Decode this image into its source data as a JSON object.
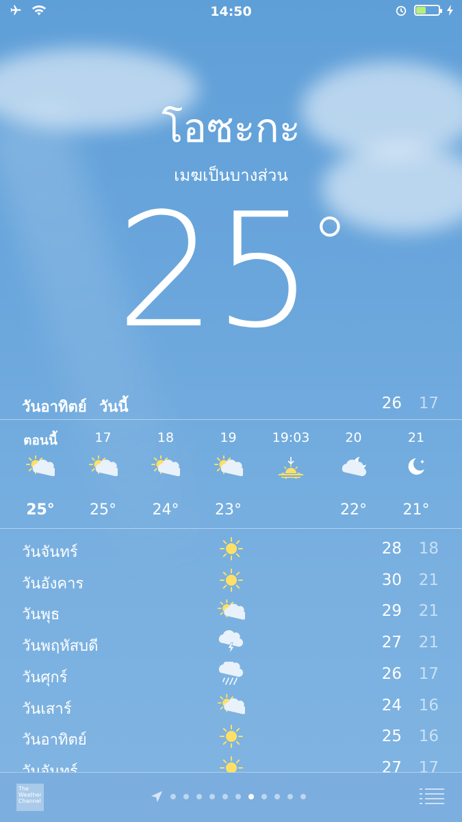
{
  "status_bar": {
    "time": "14:50"
  },
  "header": {
    "city": "โอซะกะ",
    "condition": "เมฆเป็นบางส่วน",
    "temperature": "25",
    "degree_symbol": "°"
  },
  "today": {
    "day": "วันอาทิตย์",
    "label": "วันนี้",
    "high": "26",
    "low": "17"
  },
  "hourly": [
    {
      "hour": "ตอนนี้",
      "icon": "partly-cloudy-icon",
      "temp": "25°"
    },
    {
      "hour": "17",
      "icon": "partly-cloudy-icon",
      "temp": "25°"
    },
    {
      "hour": "18",
      "icon": "partly-cloudy-icon",
      "temp": "24°"
    },
    {
      "hour": "19",
      "icon": "partly-cloudy-icon",
      "temp": "23°"
    },
    {
      "hour": "19:03",
      "icon": "sunset-icon",
      "temp": ""
    },
    {
      "hour": "20",
      "icon": "cloudy-night-icon",
      "temp": "22°"
    },
    {
      "hour": "21",
      "icon": "moon-icon",
      "temp": "21°"
    }
  ],
  "daily": [
    {
      "day": "วันจันทร์",
      "icon": "sun-icon",
      "high": "28",
      "low": "18"
    },
    {
      "day": "วันอังคาร",
      "icon": "sun-icon",
      "high": "30",
      "low": "21"
    },
    {
      "day": "วันพุธ",
      "icon": "partly-cloudy-icon",
      "high": "29",
      "low": "21"
    },
    {
      "day": "วันพฤหัสบดี",
      "icon": "thunderstorm-icon",
      "high": "27",
      "low": "21"
    },
    {
      "day": "วันศุกร์",
      "icon": "rain-icon",
      "high": "26",
      "low": "17"
    },
    {
      "day": "วันเสาร์",
      "icon": "partly-cloudy-icon",
      "high": "24",
      "low": "16"
    },
    {
      "day": "วันอาทิตย์",
      "icon": "sun-icon",
      "high": "25",
      "low": "16"
    },
    {
      "day": "วันจันทร์",
      "icon": "sun-icon",
      "high": "27",
      "low": "17"
    }
  ],
  "bottom_bar": {
    "logo_text": "The Weather Channel",
    "page_count": 11,
    "active_page": 7
  },
  "colors": {
    "sun": "#ffe066",
    "battery_fill": "#b9ee7a"
  }
}
